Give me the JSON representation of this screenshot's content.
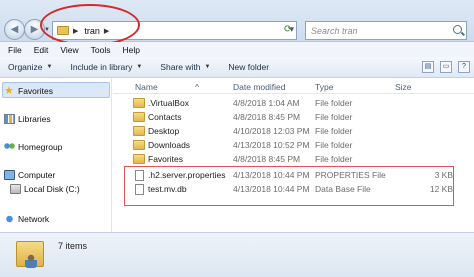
{
  "address_bar": {
    "path_root_icon": "folder-icon",
    "path_segment": "tran",
    "search_placeholder": "Search tran"
  },
  "menubar": [
    "File",
    "Edit",
    "View",
    "Tools",
    "Help"
  ],
  "toolbar": {
    "organize": "Organize",
    "include_in_library": "Include in library",
    "share_with": "Share with",
    "new_folder": "New folder"
  },
  "navigation": {
    "favorites": "Favorites",
    "libraries": "Libraries",
    "homegroup": "Homegroup",
    "computer": "Computer",
    "local_disk": "Local Disk (C:)",
    "network": "Network"
  },
  "columns": {
    "name": "Name",
    "date_modified": "Date modified",
    "type": "Type",
    "size": "Size"
  },
  "files": [
    {
      "name": ".VirtualBox",
      "date": "4/8/2018 1:04 AM",
      "type": "File folder",
      "size": "",
      "icon": "folder-icon"
    },
    {
      "name": "Contacts",
      "date": "4/8/2018 8:45 PM",
      "type": "File folder",
      "size": "",
      "icon": "folder-icon"
    },
    {
      "name": "Desktop",
      "date": "4/10/2018 12:03 PM",
      "type": "File folder",
      "size": "",
      "icon": "folder-icon"
    },
    {
      "name": "Downloads",
      "date": "4/13/2018 10:52 PM",
      "type": "File folder",
      "size": "",
      "icon": "folder-icon"
    },
    {
      "name": "Favorites",
      "date": "4/8/2018 8:45 PM",
      "type": "File folder",
      "size": "",
      "icon": "folder-icon"
    },
    {
      "name": ".h2.server.properties",
      "date": "4/13/2018 10:44 PM",
      "type": "PROPERTIES File",
      "size": "3 KB",
      "icon": "document-icon"
    },
    {
      "name": "test.mv.db",
      "date": "4/13/2018 10:44 PM",
      "type": "Data Base File",
      "size": "12 KB",
      "icon": "document-icon"
    }
  ],
  "status": {
    "items_count": "7 items"
  },
  "colors": {
    "annotation": "#d32b2b",
    "selection": "#dbe8f8"
  }
}
